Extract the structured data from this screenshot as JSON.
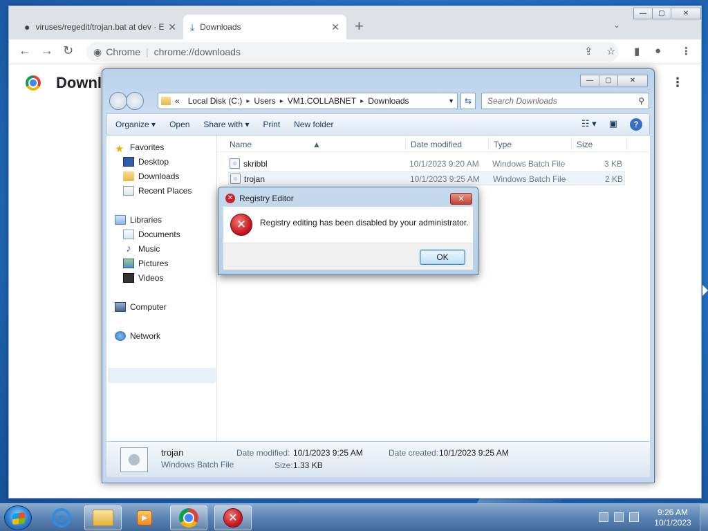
{
  "chrome": {
    "tabs": [
      {
        "title": "viruses/regedit/trojan.bat at dev · E",
        "close": "✕"
      },
      {
        "title": "Downloads",
        "close": "✕"
      }
    ],
    "new_tab": "+",
    "tab_search": "⌄",
    "window_buttons": {
      "minimize": "—",
      "maximize": "▢",
      "close": "✕"
    },
    "omnibox": {
      "site_label": "Chrome",
      "url": "chrome://downloads"
    },
    "page_title": "Downloads"
  },
  "explorer": {
    "window_buttons": {
      "minimize": "—",
      "maximize": "▢",
      "close": "✕"
    },
    "breadcrumb": [
      "Local Disk (C:)",
      "Users",
      "VM1.COLLABNET",
      "Downloads"
    ],
    "breadcrumb_overflow": "«",
    "search_placeholder": "Search Downloads",
    "commands": [
      "Organize ▾",
      "Open",
      "Share with ▾",
      "Print",
      "New folder"
    ],
    "nav": {
      "favorites": "Favorites",
      "desktop": "Desktop",
      "downloads": "Downloads",
      "recent": "Recent Places",
      "libraries": "Libraries",
      "documents": "Documents",
      "music": "Music",
      "pictures": "Pictures",
      "videos": "Videos",
      "computer": "Computer",
      "network": "Network"
    },
    "columns": {
      "name": "Name",
      "date": "Date modified",
      "type": "Type",
      "size": "Size"
    },
    "files": [
      {
        "name": "skribbl",
        "date": "10/1/2023 9:20 AM",
        "type": "Windows Batch File",
        "size": "3 KB"
      },
      {
        "name": "trojan",
        "date": "10/1/2023 9:25 AM",
        "type": "Windows Batch File",
        "size": "2 KB"
      }
    ],
    "details": {
      "name": "trojan",
      "kind": "Windows Batch File",
      "modified_label": "Date modified:",
      "modified_value": "10/1/2023 9:25 AM",
      "created_label": "Date created:",
      "created_value": "10/1/2023 9:25 AM",
      "size_label": "Size:",
      "size_value": "1.33 KB"
    }
  },
  "dialog": {
    "title": "Registry Editor",
    "message": "Registry editing has been disabled by your administrator.",
    "ok_label": "OK",
    "close": "✕"
  },
  "taskbar": {
    "clock_time": "9:26 AM",
    "clock_date": "10/1/2023"
  }
}
